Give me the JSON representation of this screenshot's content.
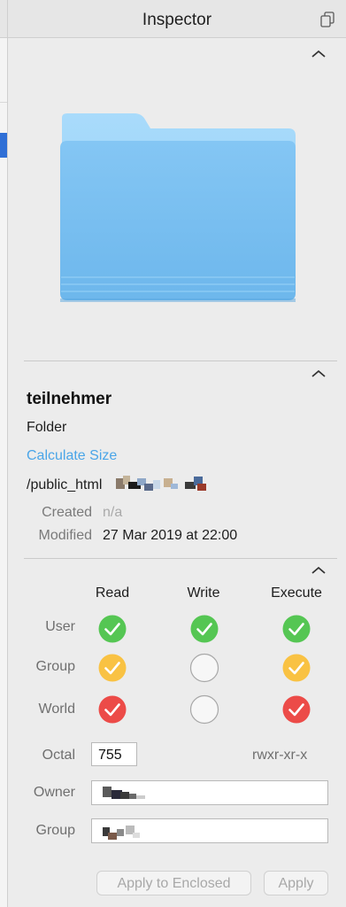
{
  "header": {
    "title": "Inspector",
    "icon": "duplicate-icon"
  },
  "file": {
    "name": "teilnehmer",
    "kind": "Folder",
    "calculate_size_label": "Calculate Size",
    "path": "/public_html",
    "created_label": "Created",
    "created_value": "n/a",
    "modified_label": "Modified",
    "modified_value": "27 Mar 2019 at 22:00"
  },
  "permissions": {
    "columns": [
      "Read",
      "Write",
      "Execute"
    ],
    "rows": [
      {
        "label": "User",
        "read": true,
        "write": true,
        "execute": true,
        "color": "#55c653"
      },
      {
        "label": "Group",
        "read": true,
        "write": false,
        "execute": true,
        "color": "#f9c243"
      },
      {
        "label": "World",
        "read": true,
        "write": false,
        "execute": true,
        "color": "#ec4b48"
      }
    ],
    "octal_label": "Octal",
    "octal_value": "755",
    "symbolic": "rwxr-xr-x",
    "owner_label": "Owner",
    "group_label": "Group"
  },
  "buttons": {
    "apply_enclosed": "Apply to Enclosed",
    "apply": "Apply"
  },
  "colors": {
    "link": "#4aa5e8",
    "folder": "#7ec4f2",
    "selection": "#2f6fd6"
  }
}
